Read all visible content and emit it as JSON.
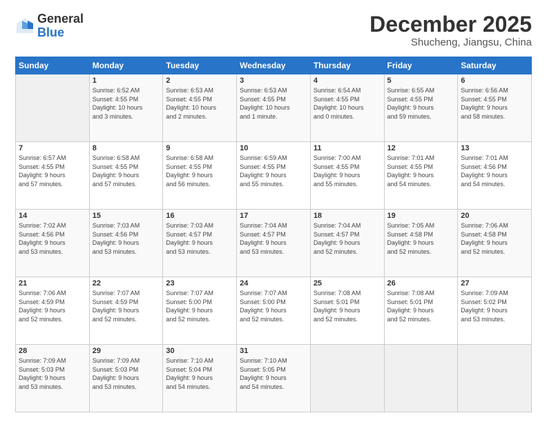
{
  "logo": {
    "general": "General",
    "blue": "Blue"
  },
  "title": "December 2025",
  "location": "Shucheng, Jiangsu, China",
  "days_header": [
    "Sunday",
    "Monday",
    "Tuesday",
    "Wednesday",
    "Thursday",
    "Friday",
    "Saturday"
  ],
  "weeks": [
    [
      {
        "num": "",
        "info": ""
      },
      {
        "num": "1",
        "info": "Sunrise: 6:52 AM\nSunset: 4:55 PM\nDaylight: 10 hours\nand 3 minutes."
      },
      {
        "num": "2",
        "info": "Sunrise: 6:53 AM\nSunset: 4:55 PM\nDaylight: 10 hours\nand 2 minutes."
      },
      {
        "num": "3",
        "info": "Sunrise: 6:53 AM\nSunset: 4:55 PM\nDaylight: 10 hours\nand 1 minute."
      },
      {
        "num": "4",
        "info": "Sunrise: 6:54 AM\nSunset: 4:55 PM\nDaylight: 10 hours\nand 0 minutes."
      },
      {
        "num": "5",
        "info": "Sunrise: 6:55 AM\nSunset: 4:55 PM\nDaylight: 9 hours\nand 59 minutes."
      },
      {
        "num": "6",
        "info": "Sunrise: 6:56 AM\nSunset: 4:55 PM\nDaylight: 9 hours\nand 58 minutes."
      }
    ],
    [
      {
        "num": "7",
        "info": "Sunrise: 6:57 AM\nSunset: 4:55 PM\nDaylight: 9 hours\nand 57 minutes."
      },
      {
        "num": "8",
        "info": "Sunrise: 6:58 AM\nSunset: 4:55 PM\nDaylight: 9 hours\nand 57 minutes."
      },
      {
        "num": "9",
        "info": "Sunrise: 6:58 AM\nSunset: 4:55 PM\nDaylight: 9 hours\nand 56 minutes."
      },
      {
        "num": "10",
        "info": "Sunrise: 6:59 AM\nSunset: 4:55 PM\nDaylight: 9 hours\nand 55 minutes."
      },
      {
        "num": "11",
        "info": "Sunrise: 7:00 AM\nSunset: 4:55 PM\nDaylight: 9 hours\nand 55 minutes."
      },
      {
        "num": "12",
        "info": "Sunrise: 7:01 AM\nSunset: 4:55 PM\nDaylight: 9 hours\nand 54 minutes."
      },
      {
        "num": "13",
        "info": "Sunrise: 7:01 AM\nSunset: 4:56 PM\nDaylight: 9 hours\nand 54 minutes."
      }
    ],
    [
      {
        "num": "14",
        "info": "Sunrise: 7:02 AM\nSunset: 4:56 PM\nDaylight: 9 hours\nand 53 minutes."
      },
      {
        "num": "15",
        "info": "Sunrise: 7:03 AM\nSunset: 4:56 PM\nDaylight: 9 hours\nand 53 minutes."
      },
      {
        "num": "16",
        "info": "Sunrise: 7:03 AM\nSunset: 4:57 PM\nDaylight: 9 hours\nand 53 minutes."
      },
      {
        "num": "17",
        "info": "Sunrise: 7:04 AM\nSunset: 4:57 PM\nDaylight: 9 hours\nand 53 minutes."
      },
      {
        "num": "18",
        "info": "Sunrise: 7:04 AM\nSunset: 4:57 PM\nDaylight: 9 hours\nand 52 minutes."
      },
      {
        "num": "19",
        "info": "Sunrise: 7:05 AM\nSunset: 4:58 PM\nDaylight: 9 hours\nand 52 minutes."
      },
      {
        "num": "20",
        "info": "Sunrise: 7:06 AM\nSunset: 4:58 PM\nDaylight: 9 hours\nand 52 minutes."
      }
    ],
    [
      {
        "num": "21",
        "info": "Sunrise: 7:06 AM\nSunset: 4:59 PM\nDaylight: 9 hours\nand 52 minutes."
      },
      {
        "num": "22",
        "info": "Sunrise: 7:07 AM\nSunset: 4:59 PM\nDaylight: 9 hours\nand 52 minutes."
      },
      {
        "num": "23",
        "info": "Sunrise: 7:07 AM\nSunset: 5:00 PM\nDaylight: 9 hours\nand 52 minutes."
      },
      {
        "num": "24",
        "info": "Sunrise: 7:07 AM\nSunset: 5:00 PM\nDaylight: 9 hours\nand 52 minutes."
      },
      {
        "num": "25",
        "info": "Sunrise: 7:08 AM\nSunset: 5:01 PM\nDaylight: 9 hours\nand 52 minutes."
      },
      {
        "num": "26",
        "info": "Sunrise: 7:08 AM\nSunset: 5:01 PM\nDaylight: 9 hours\nand 52 minutes."
      },
      {
        "num": "27",
        "info": "Sunrise: 7:09 AM\nSunset: 5:02 PM\nDaylight: 9 hours\nand 53 minutes."
      }
    ],
    [
      {
        "num": "28",
        "info": "Sunrise: 7:09 AM\nSunset: 5:03 PM\nDaylight: 9 hours\nand 53 minutes."
      },
      {
        "num": "29",
        "info": "Sunrise: 7:09 AM\nSunset: 5:03 PM\nDaylight: 9 hours\nand 53 minutes."
      },
      {
        "num": "30",
        "info": "Sunrise: 7:10 AM\nSunset: 5:04 PM\nDaylight: 9 hours\nand 54 minutes."
      },
      {
        "num": "31",
        "info": "Sunrise: 7:10 AM\nSunset: 5:05 PM\nDaylight: 9 hours\nand 54 minutes."
      },
      {
        "num": "",
        "info": ""
      },
      {
        "num": "",
        "info": ""
      },
      {
        "num": "",
        "info": ""
      }
    ]
  ]
}
